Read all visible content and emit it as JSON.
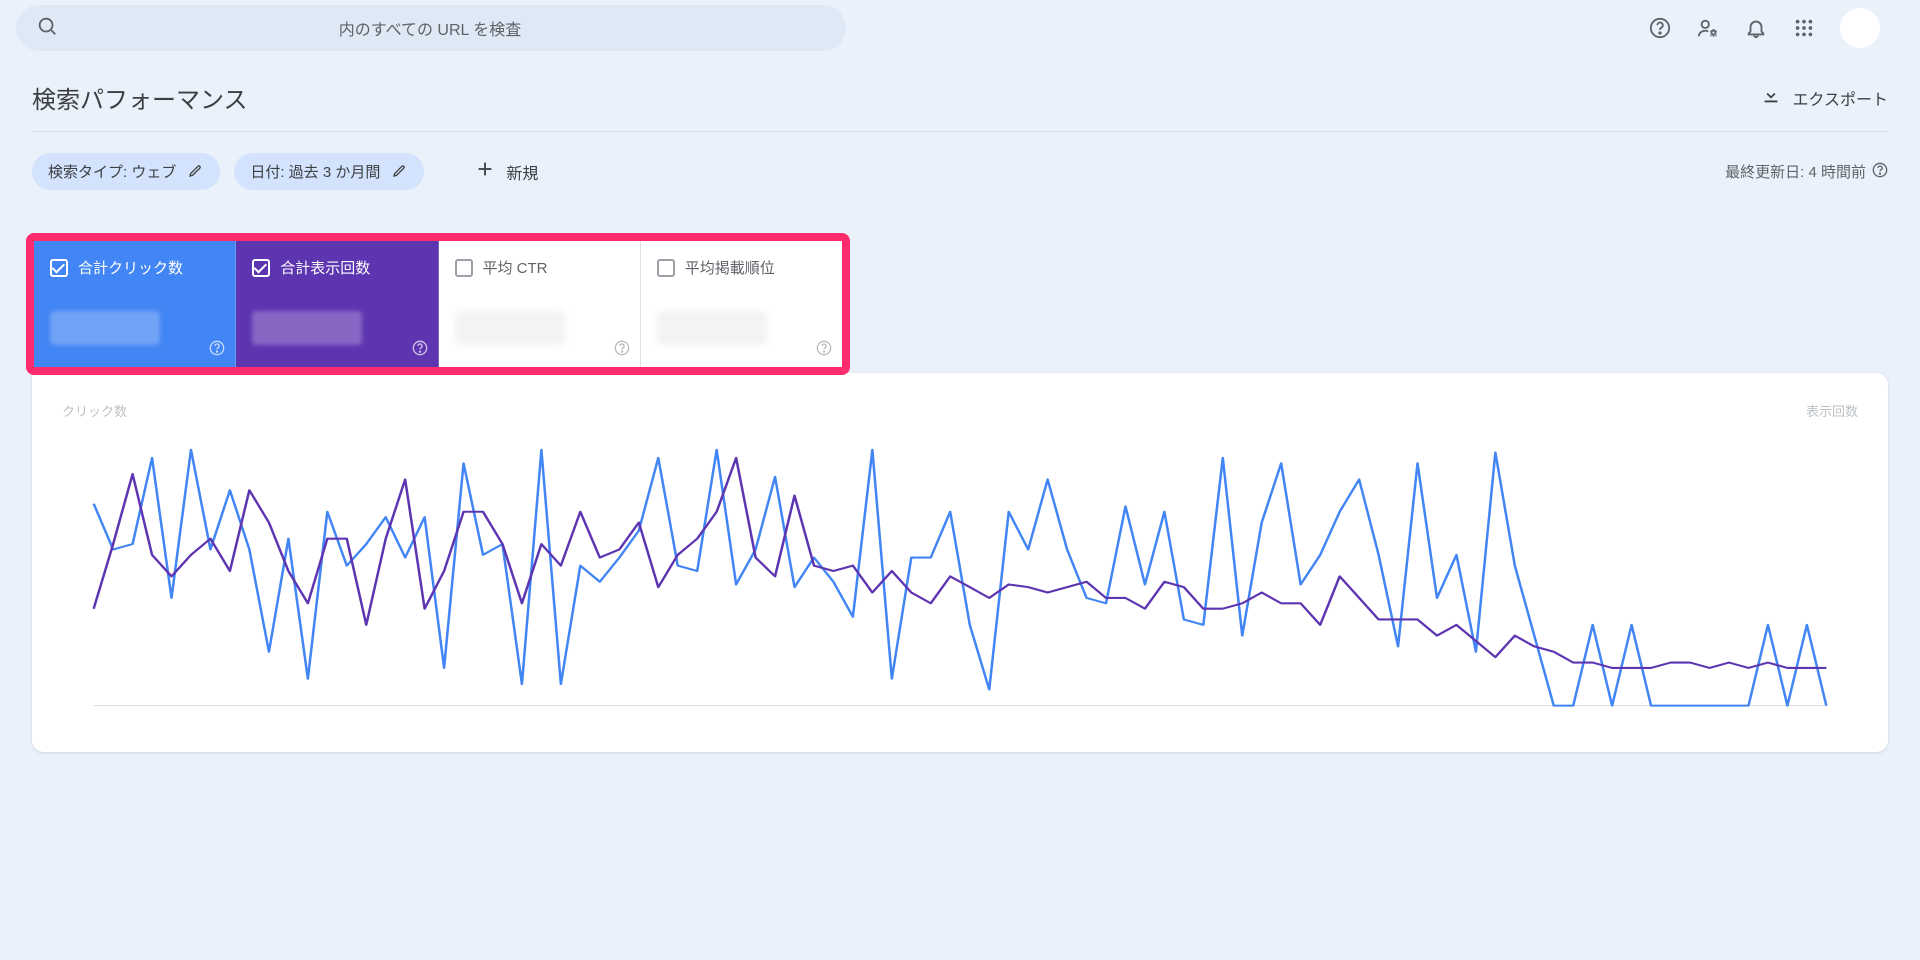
{
  "search": {
    "placeholder": "内のすべての URL を検査"
  },
  "header": {
    "title": "検索パフォーマンス",
    "export_label": "エクスポート"
  },
  "filters": {
    "chips": [
      {
        "label": "検索タイプ: ウェブ"
      },
      {
        "label": "日付: 過去 3 か月間"
      }
    ],
    "add_new_label": "新規",
    "last_updated": "最終更新日: 4 時間前"
  },
  "metrics": [
    {
      "label": "合計クリック数",
      "checked": true,
      "variant": "blue"
    },
    {
      "label": "合計表示回数",
      "checked": true,
      "variant": "purple"
    },
    {
      "label": "平均 CTR",
      "checked": false,
      "variant": "white"
    },
    {
      "label": "平均掲載順位",
      "checked": false,
      "variant": "white"
    }
  ],
  "chart": {
    "left_axis_label": "クリック数",
    "right_axis_label": "表示回数"
  },
  "colors": {
    "clicks": "#4285f4",
    "impressions": "#5e35b1",
    "highlight": "#ff2c6d"
  },
  "chart_data": {
    "type": "line",
    "title": "",
    "xlabel": "",
    "ylabel_left": "クリック数",
    "ylabel_right": "表示回数",
    "x": [
      0,
      1,
      2,
      3,
      4,
      5,
      6,
      7,
      8,
      9,
      10,
      11,
      12,
      13,
      14,
      15,
      16,
      17,
      18,
      19,
      20,
      21,
      22,
      23,
      24,
      25,
      26,
      27,
      28,
      29,
      30,
      31,
      32,
      33,
      34,
      35,
      36,
      37,
      38,
      39,
      40,
      41,
      42,
      43,
      44,
      45,
      46,
      47,
      48,
      49,
      50,
      51,
      52,
      53,
      54,
      55,
      56,
      57,
      58,
      59,
      60,
      61,
      62,
      63,
      64,
      65,
      66,
      67,
      68,
      69,
      70,
      71,
      72,
      73,
      74,
      75,
      76,
      77,
      78,
      79,
      80,
      81,
      82,
      83,
      84,
      85,
      86,
      87,
      88,
      89
    ],
    "series": [
      {
        "name": "クリック数",
        "color": "#4285f4",
        "values": [
          75,
          58,
          60,
          92,
          40,
          95,
          58,
          80,
          58,
          20,
          62,
          10,
          72,
          52,
          60,
          70,
          55,
          70,
          14,
          90,
          56,
          60,
          8,
          95,
          8,
          52,
          46,
          55,
          65,
          92,
          52,
          50,
          95,
          45,
          58,
          85,
          44,
          55,
          46,
          33,
          95,
          10,
          55,
          55,
          72,
          30,
          6,
          72,
          58,
          84,
          58,
          40,
          38,
          74,
          45,
          72,
          32,
          30,
          92,
          26,
          68,
          90,
          45,
          56,
          72,
          84,
          56,
          22,
          90,
          40,
          56,
          20,
          94,
          52,
          26,
          0,
          0,
          30,
          0,
          30,
          0,
          0,
          0,
          0,
          0,
          0,
          30,
          0,
          30,
          0
        ]
      },
      {
        "name": "表示回数",
        "color": "#5e35b1",
        "values": [
          36,
          60,
          86,
          56,
          48,
          56,
          62,
          50,
          80,
          68,
          50,
          38,
          62,
          62,
          30,
          62,
          84,
          36,
          50,
          72,
          72,
          60,
          38,
          60,
          52,
          72,
          55,
          58,
          68,
          44,
          56,
          62,
          72,
          92,
          55,
          48,
          78,
          52,
          50,
          52,
          42,
          50,
          42,
          38,
          48,
          44,
          40,
          45,
          44,
          42,
          44,
          46,
          40,
          40,
          36,
          46,
          44,
          36,
          36,
          38,
          42,
          38,
          38,
          30,
          48,
          40,
          32,
          32,
          32,
          26,
          30,
          24,
          18,
          26,
          22,
          20,
          16,
          16,
          14,
          14,
          14,
          16,
          16,
          14,
          16,
          14,
          16,
          14,
          14,
          14
        ]
      }
    ],
    "ylim": [
      0,
      100
    ]
  }
}
